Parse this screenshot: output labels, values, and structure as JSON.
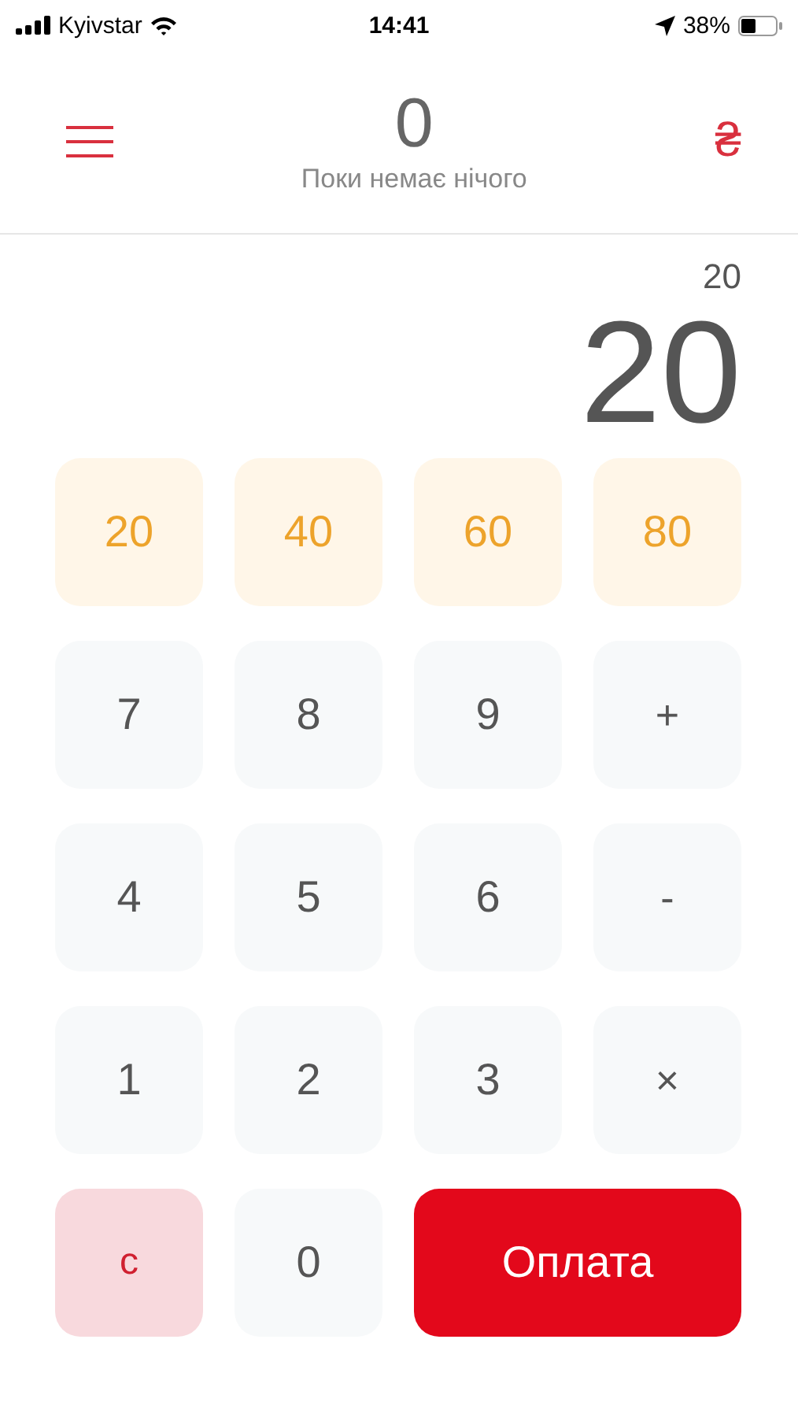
{
  "status_bar": {
    "carrier": "Kyivstar",
    "time": "14:41",
    "battery": "38%"
  },
  "header": {
    "total": "0",
    "subtitle": "Поки немає нічого",
    "currency": "₴"
  },
  "display": {
    "expression": "20",
    "result": "20"
  },
  "keys": [
    {
      "label": "20",
      "kind": "preset"
    },
    {
      "label": "40",
      "kind": "preset"
    },
    {
      "label": "60",
      "kind": "preset"
    },
    {
      "label": "80",
      "kind": "preset"
    },
    {
      "label": "7",
      "kind": "digit"
    },
    {
      "label": "8",
      "kind": "digit"
    },
    {
      "label": "9",
      "kind": "digit"
    },
    {
      "label": "+",
      "kind": "operator"
    },
    {
      "label": "4",
      "kind": "digit"
    },
    {
      "label": "5",
      "kind": "digit"
    },
    {
      "label": "6",
      "kind": "digit"
    },
    {
      "label": "-",
      "kind": "operator"
    },
    {
      "label": "1",
      "kind": "digit"
    },
    {
      "label": "2",
      "kind": "digit"
    },
    {
      "label": "3",
      "kind": "digit"
    },
    {
      "label": "×",
      "kind": "operator"
    },
    {
      "label": "c",
      "kind": "clear"
    },
    {
      "label": "0",
      "kind": "digit"
    },
    {
      "label": "Оплата",
      "kind": "pay"
    }
  ]
}
